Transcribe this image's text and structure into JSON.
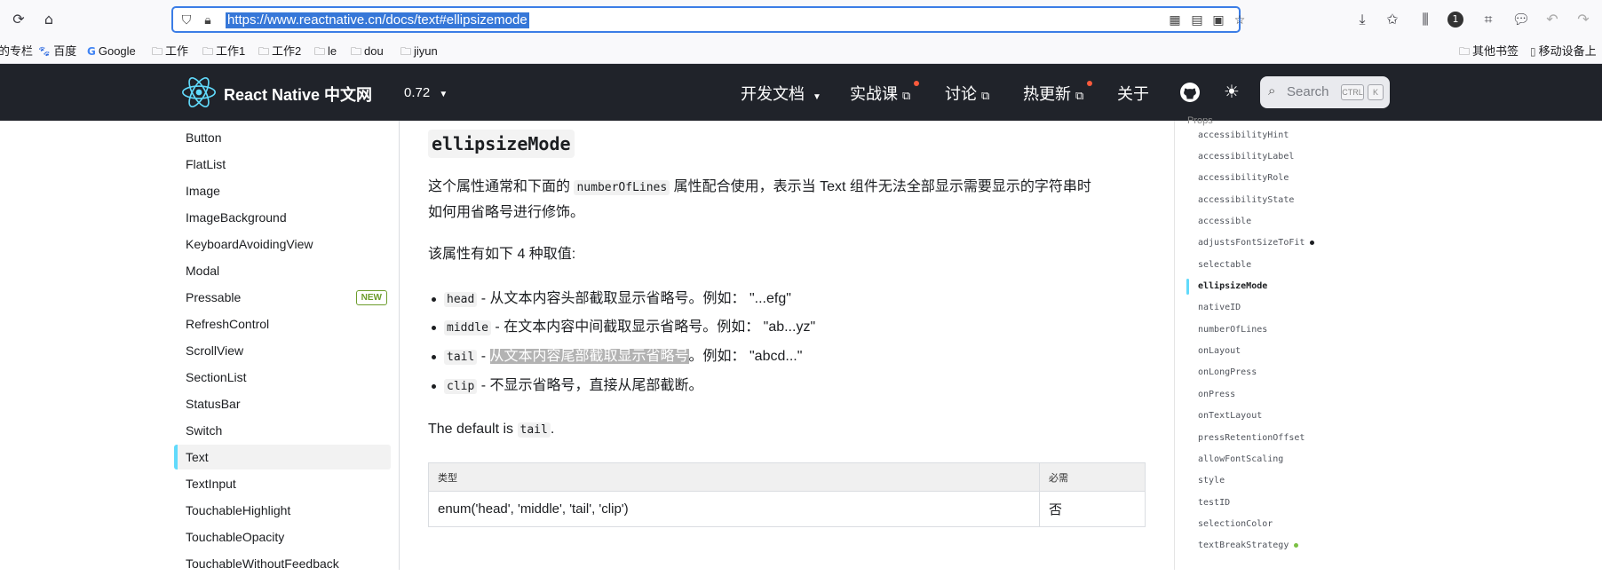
{
  "browser": {
    "url": "https://www.reactnative.cn/docs/text#ellipsizemode",
    "bookmarks": [
      {
        "label": "的专栏",
        "icon": "none"
      },
      {
        "label": "百度",
        "icon": "baidu-icon"
      },
      {
        "label": "Google",
        "icon": "google-icon"
      },
      {
        "label": "工作",
        "icon": "folder-icon"
      },
      {
        "label": "工作1",
        "icon": "folder-icon"
      },
      {
        "label": "工作2",
        "icon": "folder-icon"
      },
      {
        "label": "le",
        "icon": "folder-icon"
      },
      {
        "label": "dou",
        "icon": "folder-icon"
      },
      {
        "label": "jiyun",
        "icon": "folder-icon"
      }
    ],
    "bookmarks_right": [
      {
        "label": "其他书签",
        "icon": "folder-icon"
      },
      {
        "label": "移动设备上",
        "icon": "mobile-icon"
      }
    ]
  },
  "navbar": {
    "brand": "React Native 中文网",
    "version": "0.72",
    "items": [
      {
        "label": "开发文档",
        "has_dropdown": true
      },
      {
        "label": "实战课",
        "external": true,
        "dot": true
      },
      {
        "label": "讨论",
        "external": true
      },
      {
        "label": "热更新",
        "external": true,
        "dot": true
      },
      {
        "label": "关于"
      }
    ],
    "search_placeholder": "Search",
    "search_key1": "CTRL",
    "search_key2": "K"
  },
  "sidebar": {
    "items": [
      {
        "label": "Button"
      },
      {
        "label": "FlatList"
      },
      {
        "label": "Image"
      },
      {
        "label": "ImageBackground"
      },
      {
        "label": "KeyboardAvoidingView"
      },
      {
        "label": "Modal"
      },
      {
        "label": "Pressable",
        "badge": "NEW"
      },
      {
        "label": "RefreshControl"
      },
      {
        "label": "ScrollView"
      },
      {
        "label": "SectionList"
      },
      {
        "label": "StatusBar"
      },
      {
        "label": "Switch"
      },
      {
        "label": "Text",
        "active": true
      },
      {
        "label": "TextInput"
      },
      {
        "label": "TouchableHighlight"
      },
      {
        "label": "TouchableOpacity"
      },
      {
        "label": "TouchableWithoutFeedback"
      }
    ]
  },
  "main": {
    "heading": "ellipsizeMode",
    "intro_before": "这个属性通常和下面的",
    "intro_code": "numberOfLines",
    "intro_after_line1": "属性配合使用，表示当 Text 组件无法全部显示需要显示的字符串时",
    "intro_line2": "如何用省略号进行修饰。",
    "values_intro": "该属性有如下 4 种取值:",
    "bullets": [
      {
        "code": "head",
        "dash": " - ",
        "text": "从文本内容头部截取显示省略号。例如：  \"...efg\""
      },
      {
        "code": "middle",
        "dash": " - ",
        "text": "在文本内容中间截取显示省略号。例如：  \"ab...yz\""
      },
      {
        "code": "tail",
        "dash": " - ",
        "highlight": "从文本内容尾部截取显示省略号",
        "text": "。例如：  \"abcd...\""
      },
      {
        "code": "clip",
        "dash": " - ",
        "text": "不显示省略号，直接从尾部截断。"
      }
    ],
    "default_before": "The default is",
    "default_code": "tail",
    "default_after": ".",
    "table": {
      "headers": [
        "类型",
        "必需"
      ],
      "rows": [
        [
          "enum('head', 'middle', 'tail', 'clip')",
          "否"
        ]
      ]
    }
  },
  "toc": {
    "partial_top": "Props",
    "items": [
      {
        "label": "accessibilityHint"
      },
      {
        "label": "accessibilityLabel"
      },
      {
        "label": "accessibilityRole"
      },
      {
        "label": "accessibilityState"
      },
      {
        "label": "accessible"
      },
      {
        "label": "adjustsFontSizeToFit",
        "dot": "#1c1e21"
      },
      {
        "label": "selectable"
      },
      {
        "label": "ellipsizeMode",
        "active": true
      },
      {
        "label": "nativeID"
      },
      {
        "label": "numberOfLines"
      },
      {
        "label": "onLayout"
      },
      {
        "label": "onLongPress"
      },
      {
        "label": "onPress"
      },
      {
        "label": "onTextLayout"
      },
      {
        "label": "pressRetentionOffset"
      },
      {
        "label": "allowFontScaling"
      },
      {
        "label": "style"
      },
      {
        "label": "testID"
      },
      {
        "label": "selectionColor"
      },
      {
        "label": "textBreakStrategy",
        "dot": "#7bc043"
      }
    ]
  }
}
